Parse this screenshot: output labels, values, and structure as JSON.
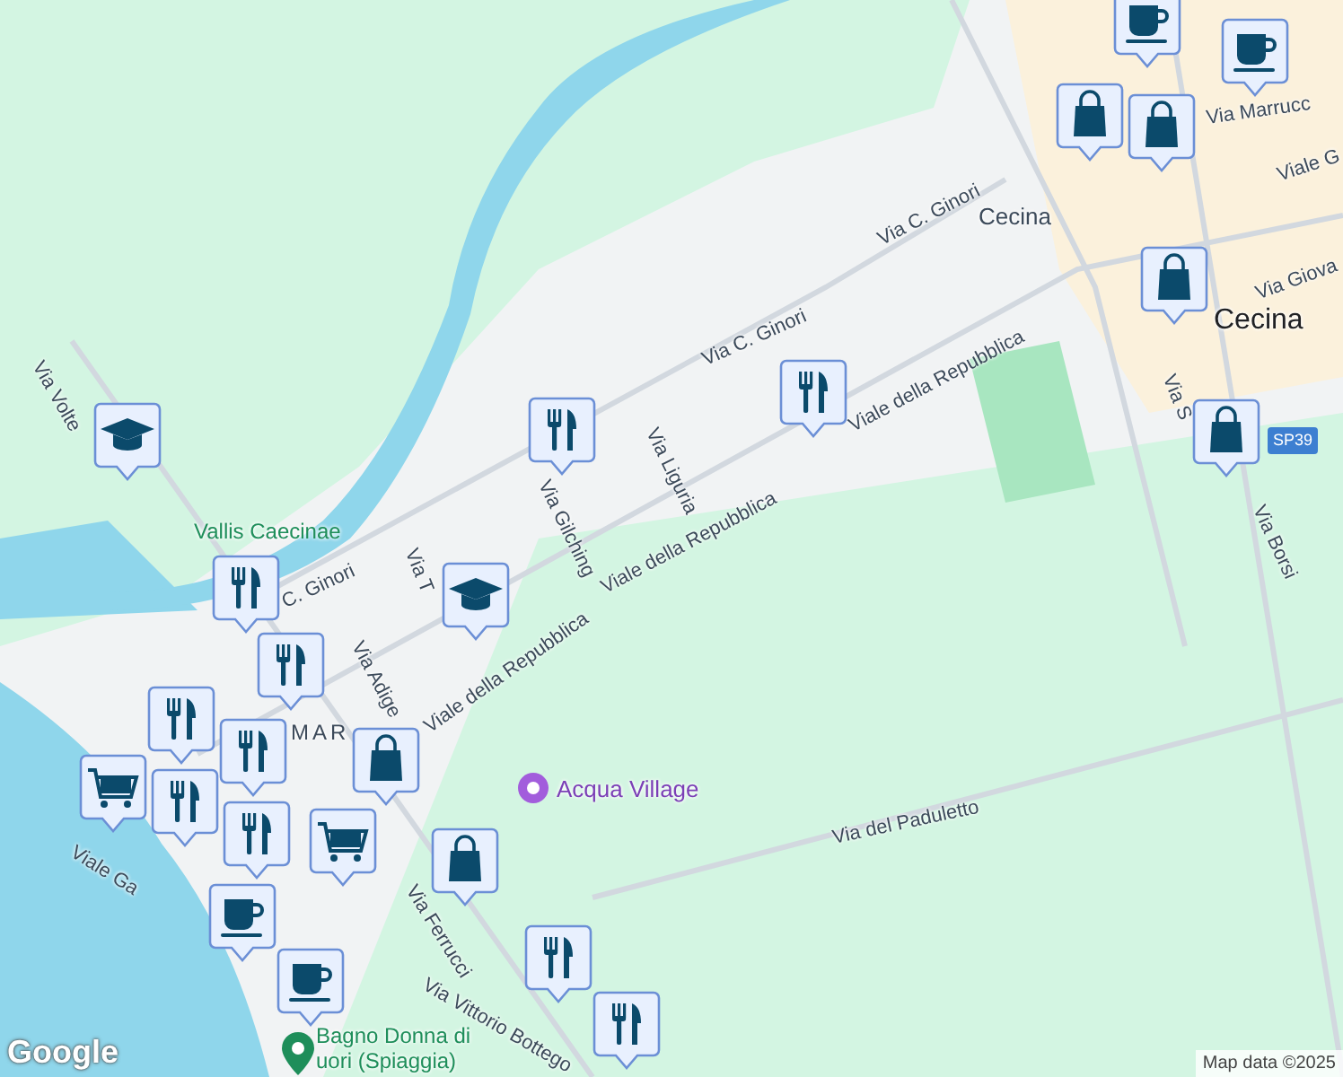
{
  "map": {
    "labels": [
      {
        "text": "Via Volte",
        "kind": "street"
      },
      {
        "text": "Via Marrucc",
        "kind": "street"
      },
      {
        "text": "Viale G",
        "kind": "street"
      },
      {
        "text": "Via C. Ginori",
        "kind": "street"
      },
      {
        "text": "Cecina",
        "kind": "station"
      },
      {
        "text": "Via Giova",
        "kind": "street"
      },
      {
        "text": "Cecina",
        "kind": "town"
      },
      {
        "text": "Via C. Ginori",
        "kind": "street"
      },
      {
        "text": "Viale della Repubblica",
        "kind": "street"
      },
      {
        "text": "SP39",
        "kind": "route"
      },
      {
        "text": "Via S",
        "kind": "street"
      },
      {
        "text": "Via Borsi",
        "kind": "street"
      },
      {
        "text": "Via Liguria",
        "kind": "street"
      },
      {
        "text": "Via Gilching",
        "kind": "street"
      },
      {
        "text": "Viale della Repubblica",
        "kind": "street"
      },
      {
        "text": "Vallis Caecinae",
        "kind": "park"
      },
      {
        "text": "C. Ginori",
        "kind": "street"
      },
      {
        "text": "Via T",
        "kind": "street"
      },
      {
        "text": "Via Adige",
        "kind": "street"
      },
      {
        "text": "Viale della Repubblica",
        "kind": "street"
      },
      {
        "text": "MAR",
        "kind": "district"
      },
      {
        "text": "Viale Ga",
        "kind": "street"
      },
      {
        "text": "Acqua Village",
        "kind": "attraction"
      },
      {
        "text": "Via del Paduletto",
        "kind": "street"
      },
      {
        "text": "Via Ferrucci",
        "kind": "street"
      },
      {
        "text": "Via Vittorio Bottego",
        "kind": "street"
      },
      {
        "text": "Bagno Donna di",
        "kind": "park"
      },
      {
        "text": "uori (Spiaggia)",
        "kind": "park"
      }
    ],
    "pins": [
      {
        "kind": "cafe"
      },
      {
        "kind": "cafe"
      },
      {
        "kind": "shop"
      },
      {
        "kind": "shop"
      },
      {
        "kind": "shop"
      },
      {
        "kind": "restaurant"
      },
      {
        "kind": "school"
      },
      {
        "kind": "shop"
      },
      {
        "kind": "restaurant"
      },
      {
        "kind": "school"
      },
      {
        "kind": "restaurant"
      },
      {
        "kind": "restaurant"
      },
      {
        "kind": "restaurant"
      },
      {
        "kind": "grocery"
      },
      {
        "kind": "restaurant"
      },
      {
        "kind": "restaurant"
      },
      {
        "kind": "shop"
      },
      {
        "kind": "grocery"
      },
      {
        "kind": "restaurant"
      },
      {
        "kind": "shop"
      },
      {
        "kind": "cafe"
      },
      {
        "kind": "cafe"
      },
      {
        "kind": "restaurant"
      },
      {
        "kind": "restaurant"
      }
    ],
    "logo": "Google",
    "attribution": "Map data ©2025"
  }
}
